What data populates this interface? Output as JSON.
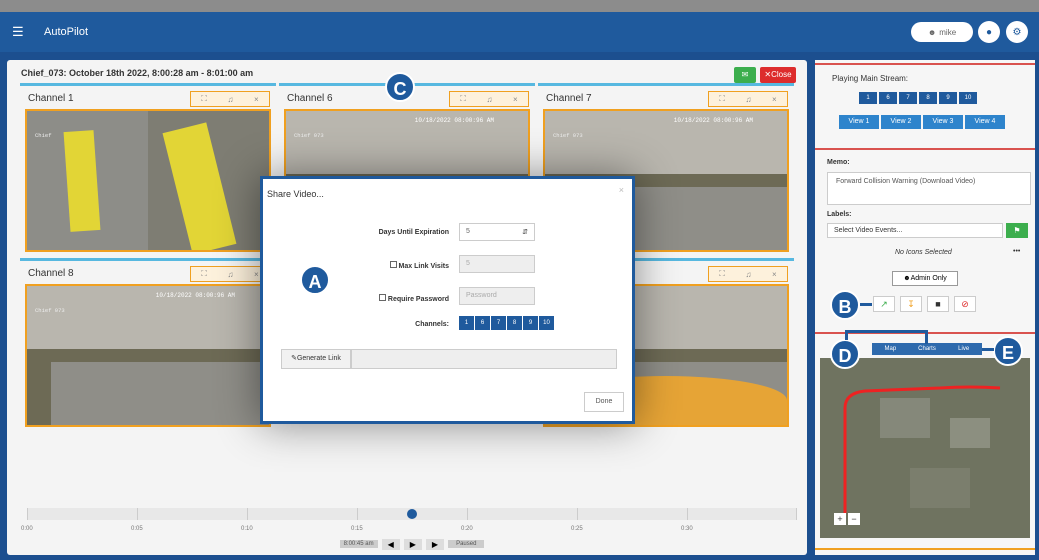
{
  "app": {
    "title": "AutoPilot",
    "user": "mike"
  },
  "main": {
    "title": "Chief_073: October 18th 2022, 8:00:28 am - 8:01:00 am",
    "close_label": "Close"
  },
  "channels": [
    {
      "label": "Channel 1",
      "timestamp": "",
      "cam": "Chief"
    },
    {
      "label": "Channel 6",
      "timestamp": "10/18/2022  08:00:96 AM",
      "cam": "Chief   073"
    },
    {
      "label": "Channel 7",
      "timestamp": "10/18/2022  08:00:96 AM",
      "cam": "Chief   073"
    },
    {
      "label": "Channel 8",
      "timestamp": "10/18/2022  08:00:96 AM",
      "cam": "Chief   073"
    },
    {
      "label": "",
      "timestamp": "",
      "cam": ""
    }
  ],
  "timeline": {
    "labels": [
      "0:00",
      "0:05",
      "0:10",
      "0:15",
      "0:20",
      "0:25",
      "0:30"
    ],
    "current": "8:00:45 am",
    "status": "Paused",
    "progress": 0.52
  },
  "sidebar": {
    "playing_label": "Playing Main Stream:",
    "channels": [
      "1",
      "6",
      "7",
      "8",
      "9",
      "10"
    ],
    "views": [
      "View 1",
      "View 2",
      "View 3",
      "View 4"
    ],
    "memo_label": "Memo:",
    "memo_value": "Forward Collision Warning (Download Video)",
    "labels_label": "Labels:",
    "labels_placeholder": "Select Video Events...",
    "no_icons": "No Icons Selected",
    "more": "•••",
    "admin_only": "Admin Only",
    "map_tabs": [
      "Map",
      "Charts",
      "Live"
    ]
  },
  "modal": {
    "title": "Share Video...",
    "days_label": "Days Until Expiration",
    "days_value": "5",
    "max_visits_label": "Max Link Visits",
    "max_visits_value": "5",
    "password_label": "Require Password",
    "password_placeholder": "Password",
    "channels_label": "Channels:",
    "channels": [
      "1",
      "6",
      "7",
      "8",
      "9",
      "10"
    ],
    "generate_label": "Generate Link",
    "done_label": "Done"
  },
  "callouts": {
    "a": "A",
    "b": "B",
    "c": "C",
    "d": "D",
    "e": "E"
  },
  "colors": {
    "nav": "#1f5a9d",
    "accent": "#f0a020",
    "panel_line": "#57b8e0",
    "danger": "#dd2c2c",
    "success": "#3cae4d"
  }
}
